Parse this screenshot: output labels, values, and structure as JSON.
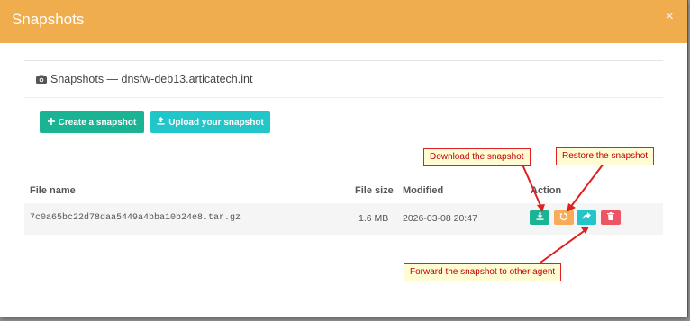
{
  "modal": {
    "title": "Snapshots",
    "close_label": "×"
  },
  "panel": {
    "heading": "Snapshots — dnsfw-deb13.articatech.int"
  },
  "buttons": {
    "create": "Create a snapshot",
    "upload": "Upload your snapshot"
  },
  "table": {
    "columns": {
      "filename": "File name",
      "filesize": "File size",
      "modified": "Modified",
      "action": "Action"
    },
    "rows": [
      {
        "filename": "7c0a65bc22d78daa5449a4bba10b24e8.tar.gz",
        "filesize": "1.6 MB",
        "modified": "2026-03-08 20:47"
      }
    ]
  },
  "annotations": {
    "download": "Download the snapshot",
    "restore": "Restore the snapshot",
    "forward": "Forward the snapshot to other agent"
  },
  "colors": {
    "header": "#f0ad4e",
    "primary": "#1ab394",
    "info": "#23c6c8",
    "warning": "#f8ac59",
    "danger": "#ed5565",
    "annotation_border": "#e02020"
  },
  "icons": {
    "camera": "camera-icon",
    "plus": "plus-icon",
    "upload": "upload-icon",
    "download": "download-icon",
    "restore": "restore-icon",
    "forward": "forward-icon",
    "trash": "trash-icon",
    "close": "close-icon"
  }
}
